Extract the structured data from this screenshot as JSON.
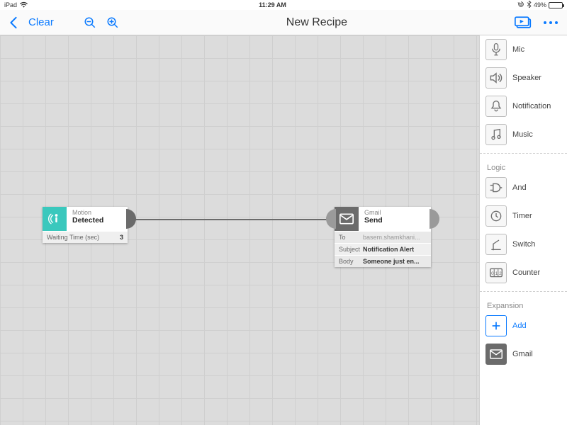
{
  "status": {
    "device": "iPad",
    "time": "11:29 AM",
    "battery_pct_text": "49%",
    "battery_pct": 49
  },
  "toolbar": {
    "clear": "Clear",
    "title": "New Recipe"
  },
  "nodes": {
    "motion": {
      "category": "Motion",
      "action": "Detected",
      "wait_label": "Waiting Time (sec)",
      "wait_value": "3"
    },
    "gmail": {
      "category": "Gmail",
      "action": "Send",
      "to_label": "To",
      "to_value": "basem.shamkhani...",
      "subject_label": "Subject",
      "subject_value": "Notification Alert",
      "body_label": "Body",
      "body_value": "Someone just en..."
    }
  },
  "sidebar": {
    "groups": {
      "outputs": [
        "Mic",
        "Speaker",
        "Notification",
        "Music"
      ],
      "logic_header": "Logic",
      "logic": [
        "And",
        "Timer",
        "Switch",
        "Counter"
      ],
      "expansion_header": "Expansion",
      "expansion_add": "Add",
      "expansion_gmail": "Gmail"
    }
  }
}
